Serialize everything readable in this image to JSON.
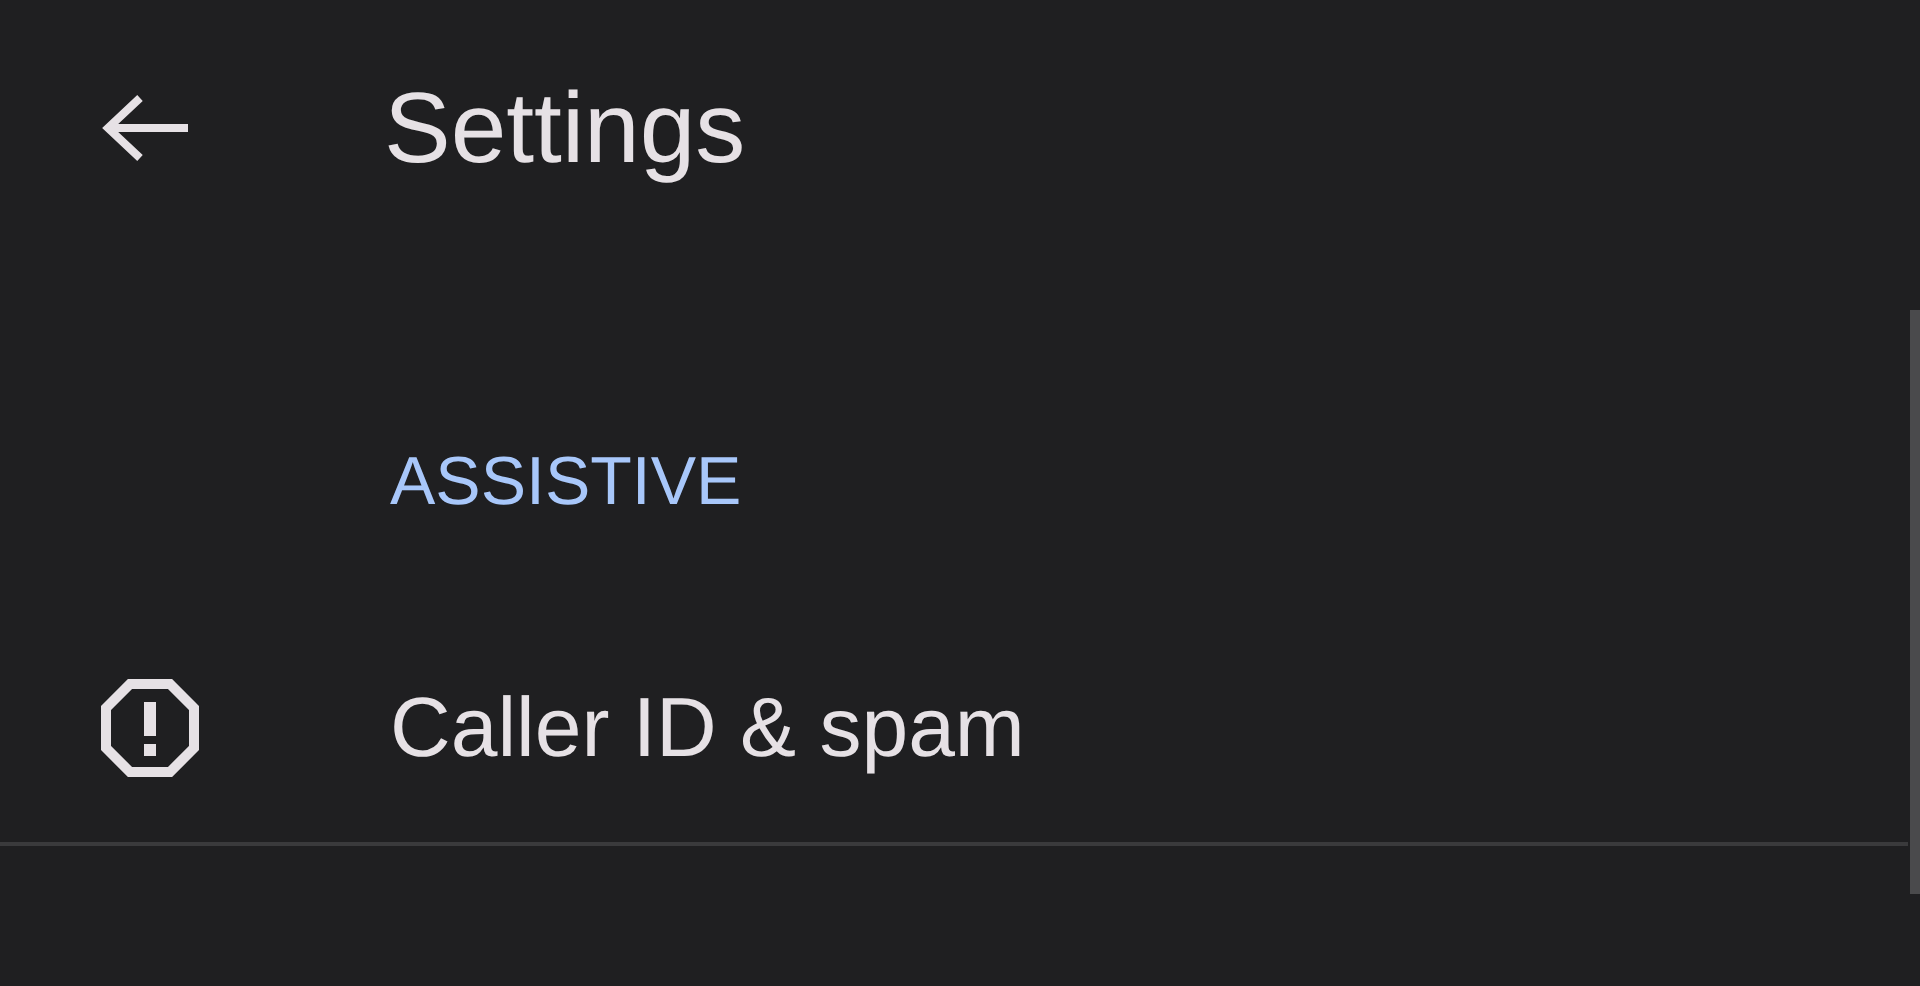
{
  "header": {
    "title": "Settings"
  },
  "sections": [
    {
      "heading": "ASSISTIVE",
      "items": [
        {
          "label": "Caller ID & spam"
        }
      ]
    }
  ]
}
